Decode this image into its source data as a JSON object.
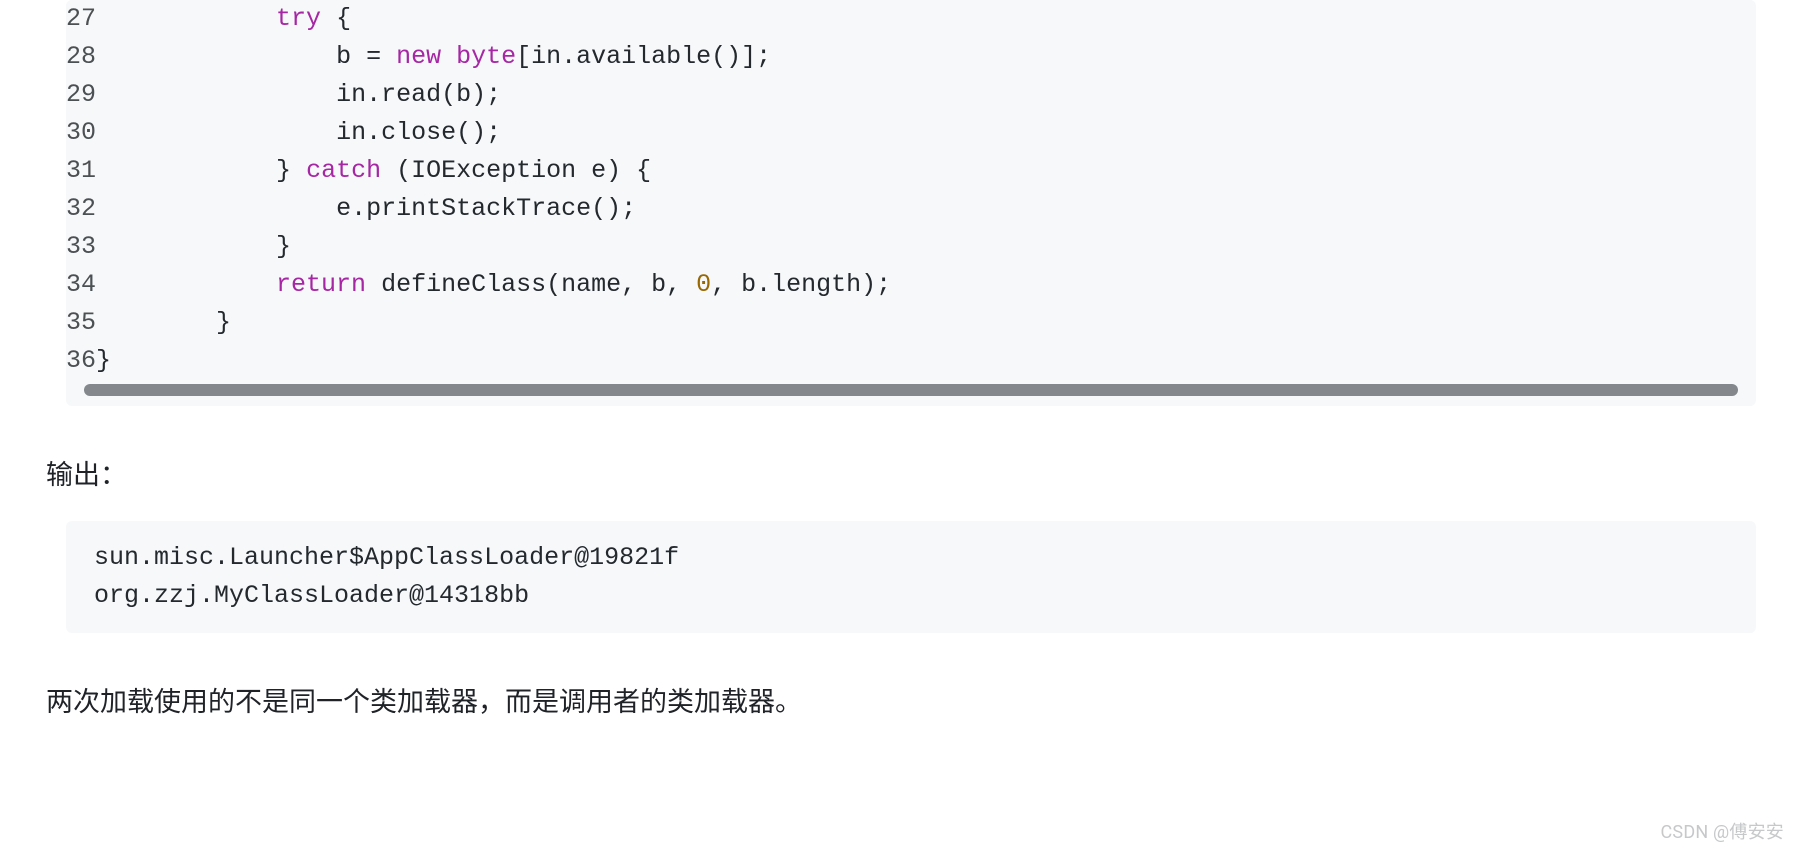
{
  "code": {
    "lines": [
      {
        "n": "27",
        "indent": "            ",
        "tokens": [
          {
            "t": "try",
            "c": "k-try"
          },
          {
            "t": " {",
            "c": ""
          }
        ]
      },
      {
        "n": "28",
        "indent": "                ",
        "tokens": [
          {
            "t": "b = ",
            "c": ""
          },
          {
            "t": "new",
            "c": "k-new"
          },
          {
            "t": " ",
            "c": ""
          },
          {
            "t": "byte",
            "c": "k-byte"
          },
          {
            "t": "[in.available()];",
            "c": ""
          }
        ]
      },
      {
        "n": "29",
        "indent": "                ",
        "tokens": [
          {
            "t": "in.read(b);",
            "c": ""
          }
        ]
      },
      {
        "n": "30",
        "indent": "                ",
        "tokens": [
          {
            "t": "in.close();",
            "c": ""
          }
        ]
      },
      {
        "n": "31",
        "indent": "            ",
        "tokens": [
          {
            "t": "} ",
            "c": ""
          },
          {
            "t": "catch",
            "c": "k-catch"
          },
          {
            "t": " (IOException e) {",
            "c": ""
          }
        ]
      },
      {
        "n": "32",
        "indent": "                ",
        "tokens": [
          {
            "t": "e.printStackTrace();",
            "c": ""
          }
        ]
      },
      {
        "n": "33",
        "indent": "            ",
        "tokens": [
          {
            "t": "}",
            "c": ""
          }
        ]
      },
      {
        "n": "34",
        "indent": "            ",
        "tokens": [
          {
            "t": "return",
            "c": "k-return"
          },
          {
            "t": " defineClass(name, b, ",
            "c": ""
          },
          {
            "t": "0",
            "c": "k-num"
          },
          {
            "t": ", b.length);",
            "c": ""
          }
        ]
      },
      {
        "n": "35",
        "indent": "        ",
        "tokens": [
          {
            "t": "}",
            "c": ""
          }
        ]
      },
      {
        "n": "36",
        "indent": "",
        "tokens": [
          {
            "t": "}",
            "c": ""
          }
        ]
      }
    ]
  },
  "labels": {
    "output_heading": "输出：",
    "paragraph": "两次加载使用的不是同一个类加载器，而是调用者的类加载器。",
    "watermark": "CSDN @傅安安"
  },
  "output": {
    "line1": "sun.misc.Launcher$AppClassLoader@19821f",
    "line2": "org.zzj.MyClassLoader@14318bb"
  }
}
